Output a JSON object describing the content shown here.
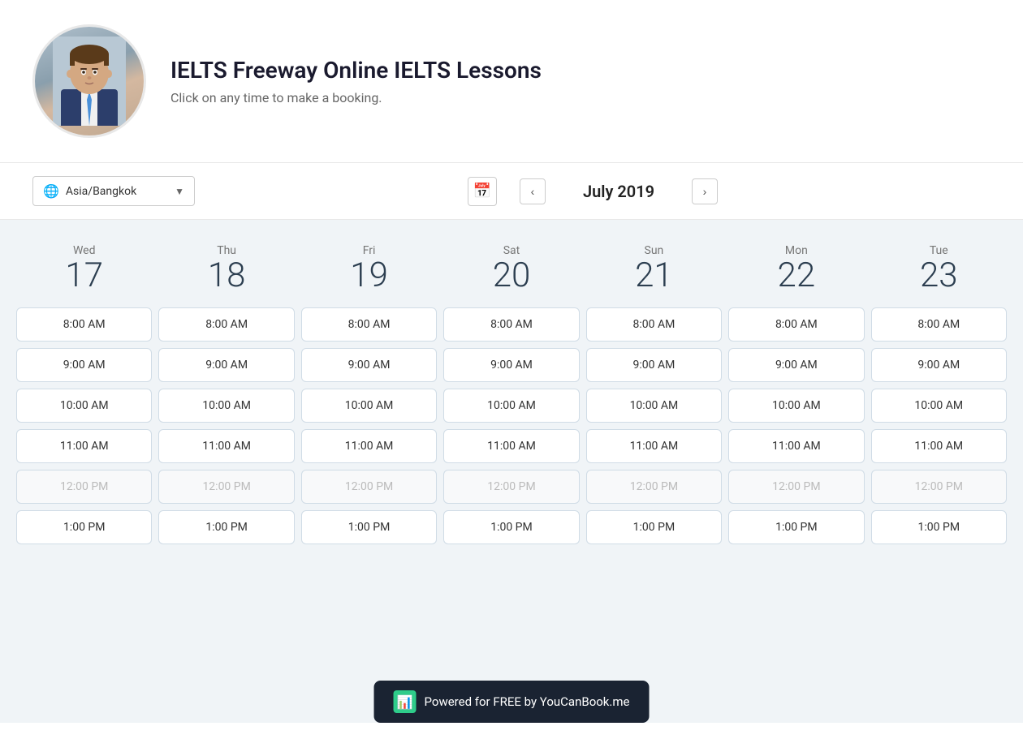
{
  "header": {
    "title": "IELTS Freeway Online IELTS Lessons",
    "subtitle": "Click on any time to make a booking."
  },
  "toolbar": {
    "timezone_label": "Asia/Bangkok",
    "month_title": "July 2019",
    "calendar_icon": "📅"
  },
  "days": [
    {
      "name": "Wed",
      "number": "17"
    },
    {
      "name": "Thu",
      "number": "18"
    },
    {
      "name": "Fri",
      "number": "19"
    },
    {
      "name": "Sat",
      "number": "20"
    },
    {
      "name": "Sun",
      "number": "21"
    },
    {
      "name": "Mon",
      "number": "22"
    },
    {
      "name": "Tue",
      "number": "23"
    }
  ],
  "time_slots": [
    {
      "label": "8:00 AM",
      "disabled": false
    },
    {
      "label": "9:00 AM",
      "disabled": false
    },
    {
      "label": "10:00 AM",
      "disabled": false
    },
    {
      "label": "11:00 AM",
      "disabled": false
    },
    {
      "label": "12:00 PM",
      "disabled": true
    },
    {
      "label": "1:00 PM",
      "disabled": false
    }
  ],
  "footer_banner": {
    "text": "Powered for FREE by YouCanBook.me",
    "icon": "📊"
  }
}
